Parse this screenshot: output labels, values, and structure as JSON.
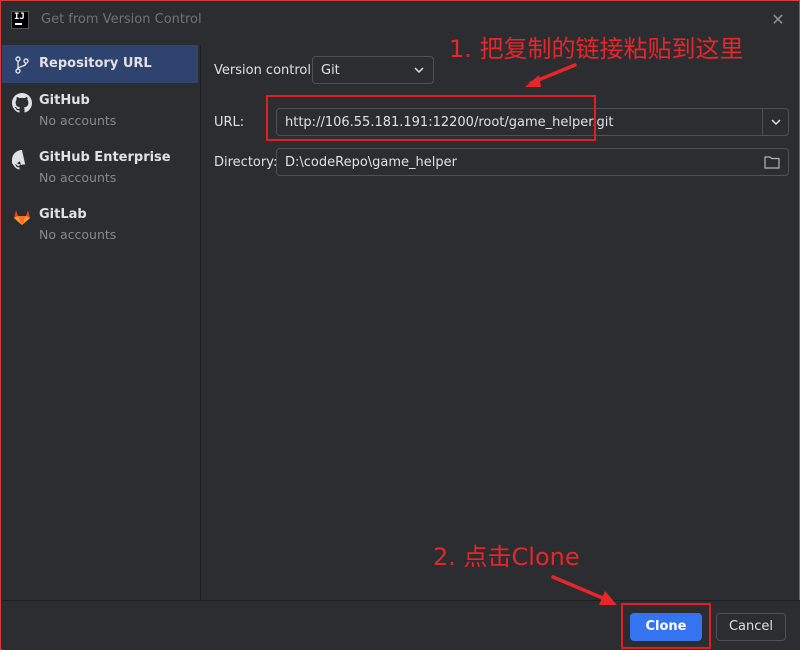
{
  "window": {
    "title": "Get from Version Control",
    "app_icon_text": "IJ",
    "close_glyph": "✕"
  },
  "sidebar": {
    "items": [
      {
        "label": "Repository URL",
        "sub": "",
        "icon": "vcs-branch-icon"
      },
      {
        "label": "GitHub",
        "sub": "No accounts",
        "icon": "github-icon"
      },
      {
        "label": "GitHub Enterprise",
        "sub": "No accounts",
        "icon": "github-icon"
      },
      {
        "label": "GitLab",
        "sub": "No accounts",
        "icon": "gitlab-icon"
      }
    ]
  },
  "form": {
    "vcs_label": "Version control:",
    "vcs_value": "Git",
    "url_label": "URL:",
    "url_value": "http://106.55.181.191:12200/root/game_helper.git",
    "dir_label": "Directory:",
    "dir_value": "D:\\codeRepo\\game_helper"
  },
  "footer": {
    "clone_label": "Clone",
    "cancel_label": "Cancel"
  },
  "annotations": {
    "step1": "1. 把复制的链接粘贴到这里",
    "step2": "2. 点击Clone"
  },
  "colors": {
    "accent": "#3574f0",
    "selection": "#2e436e",
    "annotation": "#e8262a",
    "gitlab": "#e2432a"
  }
}
